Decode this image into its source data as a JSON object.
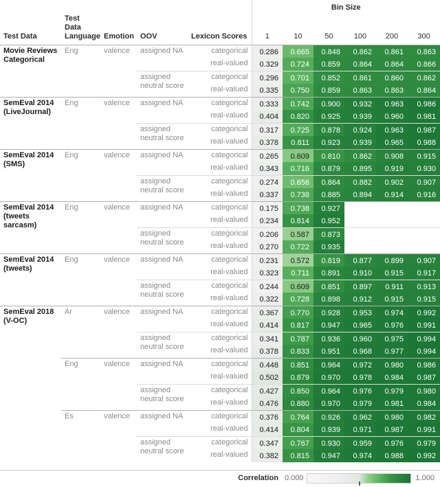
{
  "header": {
    "bin_size_title": "Bin Size",
    "columns": [
      "Test Data",
      "Test Data Language",
      "Emotion",
      "OOV",
      "Lexicon Scores"
    ],
    "bins": [
      "1",
      "10",
      "50",
      "100",
      "200",
      "300"
    ]
  },
  "legend": {
    "title": "Correlation",
    "min": "0.000",
    "max": "1.000",
    "low_color": "#ffffff",
    "mid_color": "#a8dba0",
    "high_color": "#1e7b38"
  },
  "chart_data": {
    "type": "heatmap",
    "title": "Bin Size",
    "xlabel": "Bin Size",
    "ylabel": "Test Data",
    "legend_label": "Correlation",
    "colorbar_range": [
      0.0,
      1.0
    ],
    "colorscale": [
      "#ffffff",
      "#a8dba0",
      "#1e7b38"
    ],
    "categories": [
      "1",
      "10",
      "50",
      "100",
      "200",
      "300"
    ],
    "row_fields": [
      "test_data",
      "test_data_language",
      "emotion",
      "oov",
      "lexicon_scores"
    ],
    "rows": [
      {
        "test_data": "Movie Reviews Categorical",
        "test_data_language": "Eng",
        "emotion": "valence",
        "oov": "assigned NA",
        "lexicon_scores": "categorical",
        "values": [
          0.286,
          0.665,
          0.848,
          0.862,
          0.861,
          0.863
        ]
      },
      {
        "test_data": "",
        "test_data_language": "",
        "emotion": "",
        "oov": "",
        "lexicon_scores": "real-valued",
        "values": [
          0.329,
          0.724,
          0.859,
          0.864,
          0.864,
          0.866
        ]
      },
      {
        "test_data": "",
        "test_data_language": "",
        "emotion": "",
        "oov": "assigned neutral score",
        "lexicon_scores": "categorical",
        "values": [
          0.296,
          0.701,
          0.852,
          0.861,
          0.86,
          0.862
        ]
      },
      {
        "test_data": "",
        "test_data_language": "",
        "emotion": "",
        "oov": "",
        "lexicon_scores": "real-valued",
        "values": [
          0.335,
          0.75,
          0.859,
          0.863,
          0.863,
          0.864
        ]
      },
      {
        "test_data": "SemEval 2014 (LiveJournal)",
        "test_data_language": "Eng",
        "emotion": "valence",
        "oov": "assigned NA",
        "lexicon_scores": "categorical",
        "values": [
          0.333,
          0.742,
          0.9,
          0.932,
          0.963,
          0.986
        ]
      },
      {
        "test_data": "",
        "test_data_language": "",
        "emotion": "",
        "oov": "",
        "lexicon_scores": "real-valued",
        "values": [
          0.404,
          0.82,
          0.925,
          0.939,
          0.96,
          0.981
        ]
      },
      {
        "test_data": "",
        "test_data_language": "",
        "emotion": "",
        "oov": "assigned neutral score",
        "lexicon_scores": "categorical",
        "values": [
          0.317,
          0.725,
          0.878,
          0.924,
          0.963,
          0.987
        ]
      },
      {
        "test_data": "",
        "test_data_language": "",
        "emotion": "",
        "oov": "",
        "lexicon_scores": "real-valued",
        "values": [
          0.378,
          0.811,
          0.923,
          0.939,
          0.965,
          0.988
        ]
      },
      {
        "test_data": "SemEval 2014 (SMS)",
        "test_data_language": "Eng",
        "emotion": "valence",
        "oov": "assigned NA",
        "lexicon_scores": "categorical",
        "values": [
          0.265,
          0.609,
          0.81,
          0.862,
          0.908,
          0.915
        ]
      },
      {
        "test_data": "",
        "test_data_language": "",
        "emotion": "",
        "oov": "",
        "lexicon_scores": "real-valued",
        "values": [
          0.343,
          0.716,
          0.879,
          0.895,
          0.919,
          0.93
        ]
      },
      {
        "test_data": "",
        "test_data_language": "",
        "emotion": "",
        "oov": "assigned neutral score",
        "lexicon_scores": "categorical",
        "values": [
          0.274,
          0.656,
          0.864,
          0.882,
          0.902,
          0.907
        ]
      },
      {
        "test_data": "",
        "test_data_language": "",
        "emotion": "",
        "oov": "",
        "lexicon_scores": "real-valued",
        "values": [
          0.337,
          0.738,
          0.885,
          0.894,
          0.914,
          0.916
        ]
      },
      {
        "test_data": "SemEval 2014 (tweets sarcasm)",
        "test_data_language": "Eng",
        "emotion": "valence",
        "oov": "assigned NA",
        "lexicon_scores": "categorical",
        "values": [
          0.175,
          0.738,
          0.927,
          null,
          null,
          null
        ]
      },
      {
        "test_data": "",
        "test_data_language": "",
        "emotion": "",
        "oov": "",
        "lexicon_scores": "real-valued",
        "values": [
          0.234,
          0.814,
          0.952,
          null,
          null,
          null
        ]
      },
      {
        "test_data": "",
        "test_data_language": "",
        "emotion": "",
        "oov": "assigned neutral score",
        "lexicon_scores": "categorical",
        "values": [
          0.206,
          0.587,
          0.873,
          null,
          null,
          null
        ]
      },
      {
        "test_data": "",
        "test_data_language": "",
        "emotion": "",
        "oov": "",
        "lexicon_scores": "real-valued",
        "values": [
          0.27,
          0.722,
          0.935,
          null,
          null,
          null
        ]
      },
      {
        "test_data": "SemEval 2014 (tweets)",
        "test_data_language": "Eng",
        "emotion": "valence",
        "oov": "assigned NA",
        "lexicon_scores": "categorical",
        "values": [
          0.231,
          0.572,
          0.819,
          0.877,
          0.899,
          0.907
        ]
      },
      {
        "test_data": "",
        "test_data_language": "",
        "emotion": "",
        "oov": "",
        "lexicon_scores": "real-valued",
        "values": [
          0.323,
          0.711,
          0.891,
          0.91,
          0.915,
          0.917
        ]
      },
      {
        "test_data": "",
        "test_data_language": "",
        "emotion": "",
        "oov": "assigned neutral score",
        "lexicon_scores": "categorical",
        "values": [
          0.244,
          0.609,
          0.851,
          0.897,
          0.911,
          0.913
        ]
      },
      {
        "test_data": "",
        "test_data_language": "",
        "emotion": "",
        "oov": "",
        "lexicon_scores": "real-valued",
        "values": [
          0.322,
          0.728,
          0.898,
          0.912,
          0.915,
          0.915
        ]
      },
      {
        "test_data": "SemEval 2018 (V-OC)",
        "test_data_language": "Ar",
        "emotion": "valence",
        "oov": "assigned NA",
        "lexicon_scores": "categorical",
        "values": [
          0.367,
          0.77,
          0.928,
          0.953,
          0.974,
          0.992
        ]
      },
      {
        "test_data": "",
        "test_data_language": "",
        "emotion": "",
        "oov": "",
        "lexicon_scores": "real-valued",
        "values": [
          0.414,
          0.817,
          0.947,
          0.965,
          0.976,
          0.991
        ]
      },
      {
        "test_data": "",
        "test_data_language": "",
        "emotion": "",
        "oov": "assigned neutral score",
        "lexicon_scores": "categorical",
        "values": [
          0.341,
          0.787,
          0.936,
          0.96,
          0.975,
          0.994
        ]
      },
      {
        "test_data": "",
        "test_data_language": "",
        "emotion": "",
        "oov": "",
        "lexicon_scores": "real-valued",
        "values": [
          0.378,
          0.833,
          0.951,
          0.968,
          0.977,
          0.994
        ]
      },
      {
        "test_data": "",
        "test_data_language": "Eng",
        "emotion": "valence",
        "oov": "assigned NA",
        "lexicon_scores": "categorical",
        "values": [
          0.448,
          0.851,
          0.964,
          0.972,
          0.98,
          0.986
        ]
      },
      {
        "test_data": "",
        "test_data_language": "",
        "emotion": "",
        "oov": "",
        "lexicon_scores": "real-valued",
        "values": [
          0.502,
          0.879,
          0.97,
          0.978,
          0.984,
          0.987
        ]
      },
      {
        "test_data": "",
        "test_data_language": "",
        "emotion": "",
        "oov": "assigned neutral score",
        "lexicon_scores": "categorical",
        "values": [
          0.427,
          0.85,
          0.964,
          0.976,
          0.979,
          0.98
        ]
      },
      {
        "test_data": "",
        "test_data_language": "",
        "emotion": "",
        "oov": "",
        "lexicon_scores": "real-valued",
        "values": [
          0.476,
          0.88,
          0.97,
          0.979,
          0.981,
          0.984
        ]
      },
      {
        "test_data": "",
        "test_data_language": "Es",
        "emotion": "valence",
        "oov": "assigned NA",
        "lexicon_scores": "categorical",
        "values": [
          0.376,
          0.764,
          0.926,
          0.962,
          0.98,
          0.982
        ]
      },
      {
        "test_data": "",
        "test_data_language": "",
        "emotion": "",
        "oov": "",
        "lexicon_scores": "real-valued",
        "values": [
          0.414,
          0.804,
          0.939,
          0.971,
          0.987,
          0.991
        ]
      },
      {
        "test_data": "",
        "test_data_language": "",
        "emotion": "",
        "oov": "assigned neutral score",
        "lexicon_scores": "categorical",
        "values": [
          0.347,
          0.767,
          0.93,
          0.959,
          0.976,
          0.979
        ]
      },
      {
        "test_data": "",
        "test_data_language": "",
        "emotion": "",
        "oov": "",
        "lexicon_scores": "real-valued",
        "values": [
          0.382,
          0.815,
          0.947,
          0.974,
          0.988,
          0.992
        ]
      }
    ]
  },
  "row_meta": [
    {
      "sep": "major",
      "td_rowspan": 4,
      "lang_rowspan": 4,
      "emo_rowspan": 4,
      "oov_rowspan": 2
    },
    {
      "sep": "none",
      "oov_rowspan": 0
    },
    {
      "sep": "minor",
      "oov_rowspan": 2
    },
    {
      "sep": "none",
      "oov_rowspan": 0
    },
    {
      "sep": "major",
      "td_rowspan": 4,
      "lang_rowspan": 4,
      "emo_rowspan": 4,
      "oov_rowspan": 2
    },
    {
      "sep": "none",
      "oov_rowspan": 0
    },
    {
      "sep": "minor",
      "oov_rowspan": 2
    },
    {
      "sep": "none",
      "oov_rowspan": 0
    },
    {
      "sep": "major",
      "td_rowspan": 4,
      "lang_rowspan": 4,
      "emo_rowspan": 4,
      "oov_rowspan": 2
    },
    {
      "sep": "none",
      "oov_rowspan": 0
    },
    {
      "sep": "minor",
      "oov_rowspan": 2
    },
    {
      "sep": "none",
      "oov_rowspan": 0
    },
    {
      "sep": "major",
      "td_rowspan": 4,
      "lang_rowspan": 4,
      "emo_rowspan": 4,
      "oov_rowspan": 2
    },
    {
      "sep": "none",
      "oov_rowspan": 0
    },
    {
      "sep": "minor",
      "oov_rowspan": 2
    },
    {
      "sep": "none",
      "oov_rowspan": 0
    },
    {
      "sep": "major",
      "td_rowspan": 4,
      "lang_rowspan": 4,
      "emo_rowspan": 4,
      "oov_rowspan": 2
    },
    {
      "sep": "none",
      "oov_rowspan": 0
    },
    {
      "sep": "minor",
      "oov_rowspan": 2
    },
    {
      "sep": "none",
      "oov_rowspan": 0
    },
    {
      "sep": "major",
      "td_rowspan": 12,
      "lang_rowspan": 4,
      "emo_rowspan": 4,
      "oov_rowspan": 2
    },
    {
      "sep": "none",
      "oov_rowspan": 0
    },
    {
      "sep": "minor",
      "oov_rowspan": 2
    },
    {
      "sep": "none",
      "oov_rowspan": 0
    },
    {
      "sep": "major-lang",
      "lang_rowspan": 4,
      "emo_rowspan": 4,
      "oov_rowspan": 2
    },
    {
      "sep": "none",
      "oov_rowspan": 0
    },
    {
      "sep": "minor",
      "oov_rowspan": 2
    },
    {
      "sep": "none",
      "oov_rowspan": 0
    },
    {
      "sep": "major-lang",
      "lang_rowspan": 4,
      "emo_rowspan": 4,
      "oov_rowspan": 2
    },
    {
      "sep": "none",
      "oov_rowspan": 0
    },
    {
      "sep": "minor",
      "oov_rowspan": 2
    },
    {
      "sep": "none",
      "oov_rowspan": 0
    }
  ]
}
